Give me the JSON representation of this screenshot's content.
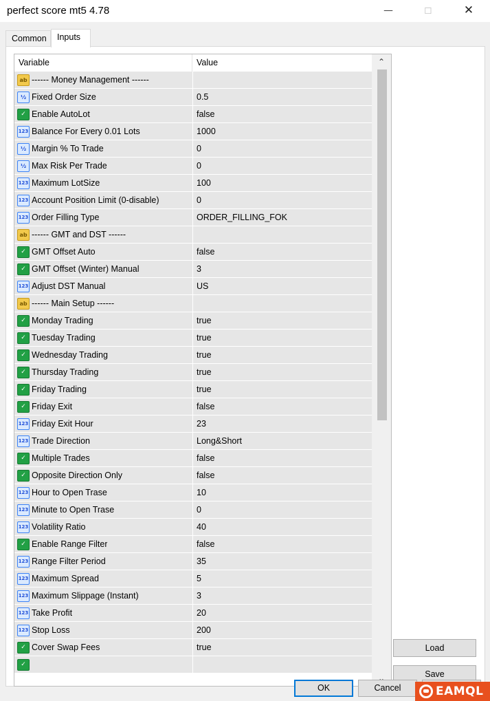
{
  "window": {
    "title": "perfect score mt5 4.78",
    "minimize_glyph": "—",
    "maximize_glyph": "☐",
    "close_glyph": "✕"
  },
  "tabs": [
    {
      "label": "Common",
      "active": false
    },
    {
      "label": "Inputs",
      "active": true
    }
  ],
  "table": {
    "headers": {
      "variable": "Variable",
      "value": "Value"
    },
    "rows": [
      {
        "icon": "string-icon",
        "name": "------ Money Management ------",
        "value": ""
      },
      {
        "icon": "double-icon",
        "name": "Fixed Order Size",
        "value": "0.5"
      },
      {
        "icon": "bool-icon",
        "name": "Enable AutoLot",
        "value": "false"
      },
      {
        "icon": "int-icon",
        "name": "Balance For Every 0.01 Lots",
        "value": "1000"
      },
      {
        "icon": "double-icon",
        "name": "Margin % To Trade",
        "value": "0"
      },
      {
        "icon": "double-icon",
        "name": "Max Risk Per Trade",
        "value": "0"
      },
      {
        "icon": "int-icon",
        "name": "Maximum LotSize",
        "value": "100"
      },
      {
        "icon": "int-icon",
        "name": "Account Position Limit (0-disable)",
        "value": "0"
      },
      {
        "icon": "enum-icon",
        "name": "Order Filling Type",
        "value": "ORDER_FILLING_FOK"
      },
      {
        "icon": "string-icon",
        "name": "------ GMT and DST ------",
        "value": ""
      },
      {
        "icon": "bool-icon",
        "name": "GMT Offset Auto",
        "value": "false"
      },
      {
        "icon": "bool-icon",
        "name": "GMT Offset (Winter) Manual",
        "value": "3"
      },
      {
        "icon": "enum-icon",
        "name": "Adjust DST Manual",
        "value": "US"
      },
      {
        "icon": "string-icon",
        "name": "------ Main Setup ------",
        "value": ""
      },
      {
        "icon": "bool-icon",
        "name": "Monday Trading",
        "value": "true"
      },
      {
        "icon": "bool-icon",
        "name": "Tuesday Trading",
        "value": "true"
      },
      {
        "icon": "bool-icon",
        "name": "Wednesday Trading",
        "value": "true"
      },
      {
        "icon": "bool-icon",
        "name": "Thursday Trading",
        "value": "true"
      },
      {
        "icon": "bool-icon",
        "name": "Friday Trading",
        "value": "true"
      },
      {
        "icon": "bool-icon",
        "name": "Friday Exit",
        "value": "false"
      },
      {
        "icon": "int-icon",
        "name": "Friday Exit Hour",
        "value": "23"
      },
      {
        "icon": "enum-icon",
        "name": "Trade Direction",
        "value": "Long&Short"
      },
      {
        "icon": "bool-icon",
        "name": "Multiple Trades",
        "value": "false"
      },
      {
        "icon": "bool-icon",
        "name": "Opposite Direction Only",
        "value": "false"
      },
      {
        "icon": "int-icon",
        "name": "Hour to Open Trase",
        "value": "10"
      },
      {
        "icon": "int-icon",
        "name": "Minute to Open Trase",
        "value": "0"
      },
      {
        "icon": "int-icon",
        "name": "Volatility Ratio",
        "value": "40"
      },
      {
        "icon": "bool-icon",
        "name": "Enable Range Filter",
        "value": "false"
      },
      {
        "icon": "int-icon",
        "name": "Range Filter Period",
        "value": "35"
      },
      {
        "icon": "int-icon",
        "name": "Maximum Spread",
        "value": "5"
      },
      {
        "icon": "int-icon",
        "name": "Maximum Slippage (Instant)",
        "value": "3"
      },
      {
        "icon": "int-icon",
        "name": "Take Profit",
        "value": "20"
      },
      {
        "icon": "int-icon",
        "name": "Stop Loss",
        "value": "200"
      },
      {
        "icon": "bool-icon",
        "name": "Cover Swap Fees",
        "value": "true"
      },
      {
        "icon": "bool-icon",
        "name": "",
        "value": ""
      }
    ]
  },
  "icon_glyphs": {
    "string-icon": "ab",
    "double-icon": "½",
    "int-icon": "123",
    "bool-icon": "✓",
    "enum-icon": "123"
  },
  "side_buttons": {
    "load": "Load",
    "save": "Save"
  },
  "footer_buttons": {
    "ok": "OK",
    "cancel": "Cancel",
    "help": ""
  },
  "watermark": {
    "text": "EAMQL"
  },
  "colors": {
    "accent": "#0078d7",
    "row_bg": "#e6e6e6",
    "watermark": "#e8501e"
  }
}
